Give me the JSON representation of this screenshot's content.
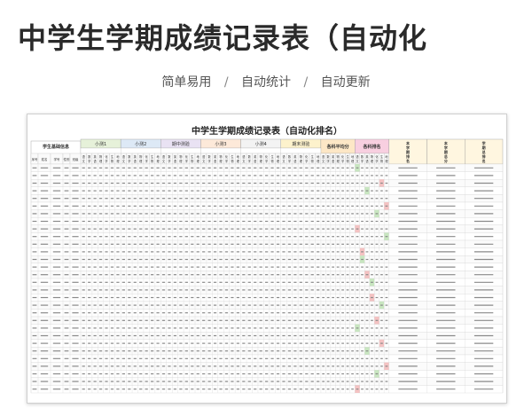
{
  "banner": {
    "headline": "中学生学期成绩记录表（自动化",
    "features": [
      "简单易用",
      "自动统计",
      "自动更新"
    ],
    "separator": "/"
  },
  "sheet": {
    "title": "中学生学期成绩记录表（自动化排名）",
    "group_headers": {
      "info": "学生基础信息",
      "exams": [
        "小测1",
        "小测2",
        "期中测验",
        "小测3",
        "小测4",
        "期末测验"
      ],
      "avg": "各科平均分",
      "rank": "各科排名",
      "totals": [
        "本学期排名",
        "本学期总分",
        "学期总排名"
      ]
    },
    "info_columns": [
      "序号",
      "姓名",
      "学号",
      "性别",
      "班级"
    ],
    "subjects": [
      "语文",
      "数学",
      "英语",
      "物理",
      "化学",
      "生物",
      "地理"
    ],
    "colors": {
      "exam_fills": [
        "#e6f1d9",
        "#dde9f6",
        "#e9e2f3",
        "#fde9d9",
        "#f3f3f3",
        "#fdf2cc"
      ],
      "avg_fill": "#fde7c6",
      "rank_fill": "#f8cfe0",
      "totals_fill": "#fff6e0",
      "highlight_green": "#c8e6c0",
      "highlight_red": "#f4c2c2"
    }
  }
}
